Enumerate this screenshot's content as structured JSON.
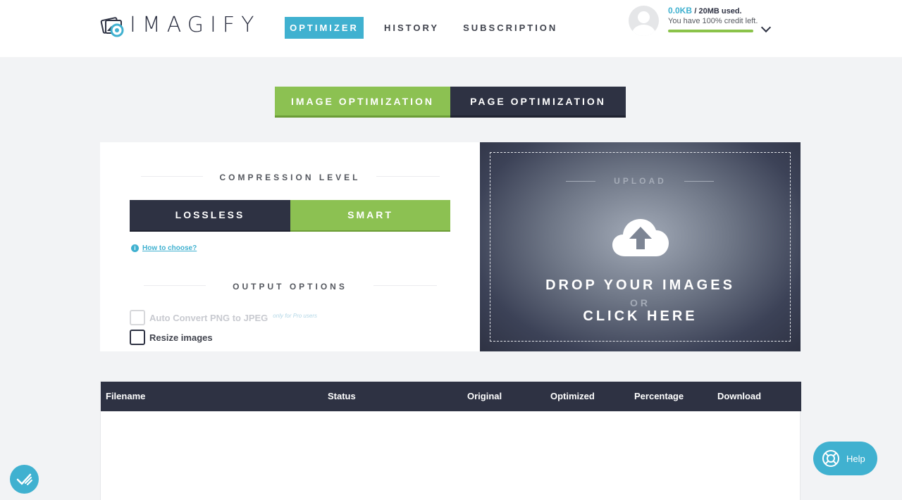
{
  "header": {
    "logo_text": "IMAGIFY",
    "nav": [
      {
        "label": "OPTIMIZER",
        "active": true
      },
      {
        "label": "HISTORY",
        "active": false
      },
      {
        "label": "SUBSCRIPTION",
        "active": false
      }
    ],
    "account": {
      "used": "0.0KB",
      "quota": "/ 20MB used.",
      "credit_text": "You have 100% credit left.",
      "credit_fraction": 1.0
    }
  },
  "tabs": [
    {
      "label": "IMAGE OPTIMIZATION",
      "active": true
    },
    {
      "label": "PAGE OPTIMIZATION",
      "active": false
    }
  ],
  "options": {
    "compression_title": "COMPRESSION LEVEL",
    "levels": [
      {
        "label": "LOSSLESS",
        "selected": false
      },
      {
        "label": "SMART",
        "selected": true
      }
    ],
    "how_to_choose": "How to choose?",
    "output_title": "OUTPUT OPTIONS",
    "auto_convert": {
      "label": "Auto Convert PNG to JPEG",
      "note": "only for Pro users",
      "disabled": true,
      "checked": false
    },
    "resize": {
      "label": "Resize images",
      "checked": false
    }
  },
  "upload": {
    "title": "UPLOAD",
    "drop_line1": "DROP YOUR IMAGES",
    "or": "OR",
    "drop_line2": "CLICK HERE"
  },
  "table": {
    "columns": [
      "Filename",
      "Status",
      "Original",
      "Optimized",
      "Percentage",
      "Download"
    ],
    "rows": []
  },
  "help": {
    "label": "Help"
  },
  "colors": {
    "accent_blue": "#40b1d0",
    "accent_green": "#8cc152",
    "dark": "#2e3243"
  }
}
